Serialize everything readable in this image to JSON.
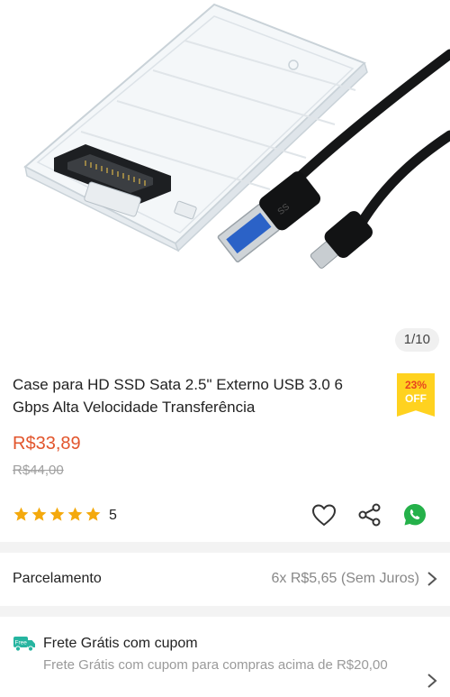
{
  "gallery": {
    "counter": "1/10"
  },
  "product": {
    "title": "Case para HD SSD Sata 2.5\" Externo USB 3.0 6 Gbps Alta Velocidade Transferência",
    "discount_percent": "23%",
    "discount_off": "OFF",
    "price": "R$33,89",
    "old_price": "R$44,00",
    "rating_stars": 5,
    "rating_count": "5"
  },
  "installment": {
    "label": "Parcelamento",
    "value": "6x R$5,65 (Sem Juros)"
  },
  "shipping": {
    "badge": "Free",
    "title": "Frete Grátis com cupom",
    "description": "Frete Grátis com cupom para compras acima de R$20,00"
  },
  "colors": {
    "price": "#e2552c",
    "discount_badge": "#ffd21f",
    "whatsapp": "#25b14a",
    "star": "#f4a90d"
  }
}
